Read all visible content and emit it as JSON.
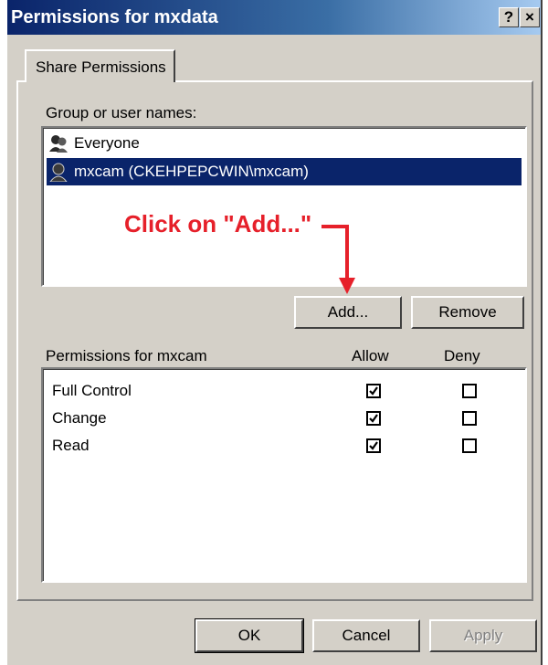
{
  "window": {
    "title": "Permissions for mxdata",
    "help_label": "?",
    "close_label": "×"
  },
  "tabs": [
    {
      "label": "Share Permissions"
    }
  ],
  "group_section": {
    "label": "Group or user names:",
    "users": [
      {
        "name": "Everyone",
        "selected": false,
        "icon": "group-icon"
      },
      {
        "name": "mxcam (CKEHPEPCWIN\\mxcam)",
        "selected": true,
        "icon": "user-icon"
      }
    ],
    "add_label": "Add...",
    "remove_label": "Remove"
  },
  "annotation": {
    "text": "Click on \"Add...\"",
    "color": "#e6202a"
  },
  "permissions": {
    "header": "Permissions for mxcam",
    "allow_label": "Allow",
    "deny_label": "Deny",
    "rows": [
      {
        "name": "Full Control",
        "allow": true,
        "deny": false
      },
      {
        "name": "Change",
        "allow": true,
        "deny": false
      },
      {
        "name": "Read",
        "allow": true,
        "deny": false
      }
    ]
  },
  "footer": {
    "ok_label": "OK",
    "cancel_label": "Cancel",
    "apply_label": "Apply"
  },
  "colors": {
    "title_bar": "#0a246a",
    "selection": "#0a246a",
    "dialog_bg": "#d4d0c8"
  }
}
